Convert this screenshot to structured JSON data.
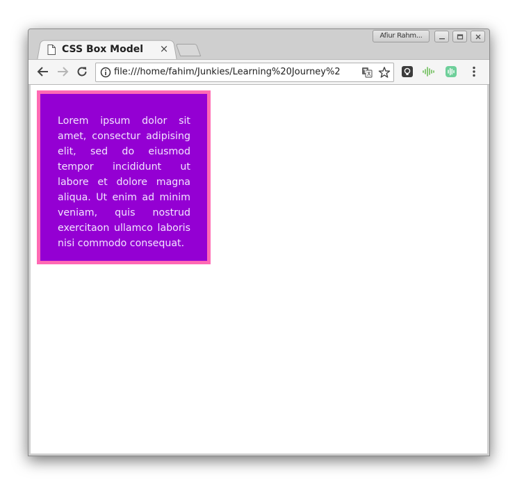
{
  "browser": {
    "tab_title": "CSS Box Model",
    "tab_close_glyph": "×",
    "profile_name": "Afiur Rahm...",
    "url": "file:///home/fahim/Junkies/Learning%20Journey%2",
    "icons": {
      "back": "back-arrow-icon",
      "forward": "forward-arrow-icon",
      "reload": "reload-icon",
      "info": "info-icon",
      "translate": "translate-icon",
      "bookmark": "star-icon",
      "extension_1": "lightbulb-extension-icon",
      "extension_2": "audio-waveform-extension-icon",
      "extension_3": "green-waveform-extension-icon",
      "menu": "kebab-menu-icon"
    }
  },
  "page": {
    "box_text": "Lorem ipsum dolor sit amet, consectur adipising elit, sed do eiusmod tempor incididunt ut labore et dolore magna aliqua. Ut enim ad minim veniam, quis nostrud exercitaon ullamco laboris nisi commodo consequat."
  },
  "colors": {
    "box_background": "#9400d3",
    "box_border": "#ff69b4",
    "box_text": "#f3e6ff"
  }
}
